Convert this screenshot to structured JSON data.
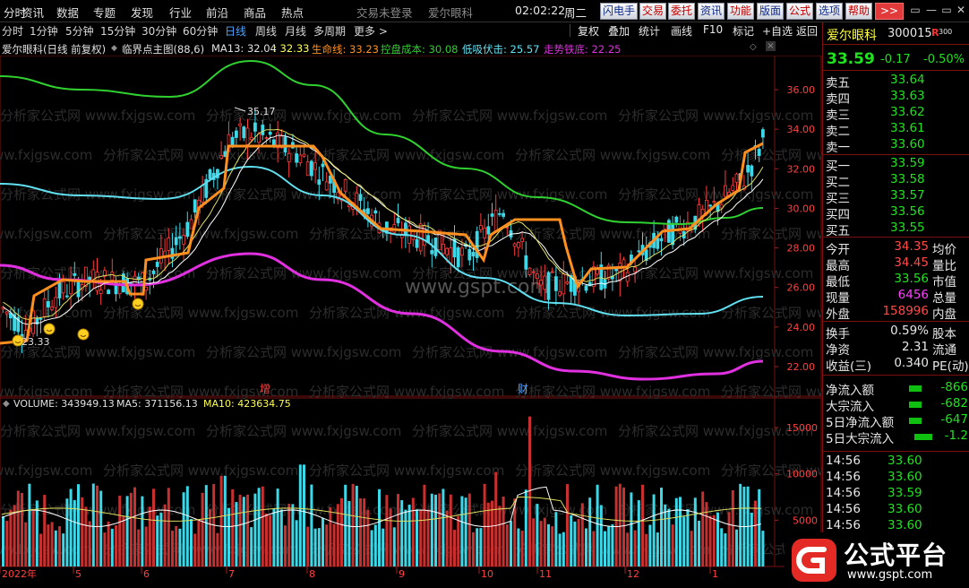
{
  "menubar": {
    "left_items": [
      "分时",
      "资讯",
      "数据",
      "专题",
      "发现",
      "行业",
      "前沿",
      "商品",
      "热点"
    ],
    "status_login": "交易未登录",
    "stock_name": "爱尔眼科",
    "time": "02:02:22",
    "weekday": "周二",
    "buttons": [
      {
        "label": "闪电手",
        "style": "blue"
      },
      {
        "label": "交易",
        "style": "red"
      },
      {
        "label": "委托",
        "style": "red"
      },
      {
        "label": "资讯",
        "style": "blue"
      },
      {
        "label": "功能",
        "style": "red"
      },
      {
        "label": "版面",
        "style": "blue"
      },
      {
        "label": "公式",
        "style": "red"
      },
      {
        "label": "选项",
        "style": "blue"
      },
      {
        "label": "帮助",
        "style": "red"
      },
      {
        "label": ">>",
        "style": "pink"
      }
    ],
    "window_buttons": [
      "▭",
      "—",
      "▭",
      "✕"
    ]
  },
  "periodbar": {
    "periods": [
      "分时",
      "1分钟",
      "5分钟",
      "15分钟",
      "30分钟",
      "60分钟",
      "日线",
      "周线",
      "月线",
      "多周期",
      "更多 >"
    ],
    "active": "日线",
    "tools": [
      "复权",
      "叠加",
      "统计",
      "画线",
      "F10",
      "标记",
      "+自选",
      "返回"
    ]
  },
  "indicator_header": {
    "title": "爱尔眼科(日线 前复权)",
    "sep": "◆",
    "formula": "临界点主图(88,6)",
    "ma13": "MA13: 32.04",
    "ma13b": ": 32.33",
    "life": "生命线: 33.23",
    "cost": "控盘成本: 30.08",
    "absorb": "低吸伏击: 25.57",
    "bottom": "走势铁底: 22.25"
  },
  "volume_header": {
    "volume": "VOLUME: 343949.13",
    "ma5": "MA5: 371156.13",
    "ma10": "MA10: 423634.75"
  },
  "chart_labels": {
    "peak": "35.17",
    "low": "23.33",
    "marker_zeng": "增",
    "marker_cai": "财",
    "watermark": "www.gspt.com",
    "watermark_repeat": "分析家公式网 www.fxjgsw.com"
  },
  "price_axis": [
    "36.00",
    "34.00",
    "32.00",
    "30.00",
    "28.00",
    "26.00",
    "24.00",
    "22.00"
  ],
  "volume_axis": [
    "15000",
    "10000",
    "5000"
  ],
  "date_axis": [
    "2022年",
    "5",
    "6",
    "7",
    "8",
    "9",
    "10",
    "11",
    "12",
    "1"
  ],
  "quote": {
    "name": "爱尔眼科",
    "code": "300015",
    "badge": "R",
    "badge_sup": "300",
    "price": "33.59",
    "change": "-0.17",
    "pct": "-0.50%",
    "asks": [
      {
        "label": "卖五",
        "price": "33.64"
      },
      {
        "label": "卖四",
        "price": "33.63"
      },
      {
        "label": "卖三",
        "price": "33.62"
      },
      {
        "label": "卖二",
        "price": "33.61"
      },
      {
        "label": "卖一",
        "price": "33.60"
      }
    ],
    "bids": [
      {
        "label": "买一",
        "price": "33.59"
      },
      {
        "label": "买二",
        "price": "33.58"
      },
      {
        "label": "买三",
        "price": "33.57"
      },
      {
        "label": "买四",
        "price": "33.56"
      },
      {
        "label": "买五",
        "price": "33.55"
      }
    ],
    "stats": [
      {
        "label": "今开",
        "value": "34.35",
        "label2": "均价"
      },
      {
        "label": "最高",
        "value": "34.45",
        "label2": "量比"
      },
      {
        "label": "最低",
        "value": "33.56",
        "label2": "市值"
      },
      {
        "label": "现量",
        "value": "6456",
        "label2": "总量"
      },
      {
        "label": "外盘",
        "value": "158996",
        "label2": "内盘"
      }
    ],
    "stats2": [
      {
        "label": "换手",
        "value": "0.59%",
        "label2": "股本"
      },
      {
        "label": "净资",
        "value": "2.31",
        "label2": "流通"
      },
      {
        "label": "收益(三)",
        "value": "0.340",
        "label2": "PE(动)"
      }
    ],
    "flows": [
      {
        "label": "净流入额",
        "value": "-866"
      },
      {
        "label": "大宗流入",
        "value": "-682"
      },
      {
        "label": "5日净流入额",
        "value": "-647"
      },
      {
        "label": "5日大宗流入",
        "value": "-1.2"
      }
    ],
    "ticks": [
      {
        "time": "14:56",
        "price": "33.60"
      },
      {
        "time": "14:56",
        "price": "33.60"
      },
      {
        "time": "14:56",
        "price": "33.59"
      },
      {
        "time": "14:56",
        "price": "33.60"
      },
      {
        "time": "14:56",
        "price": "33.60"
      }
    ]
  },
  "logo": {
    "text": "公式平台",
    "url": "www.gspt.com"
  },
  "colors": {
    "up": "#ff3c3c",
    "down": "#3cd8e8",
    "orange": "#ff9020",
    "green": "#30d030",
    "cyan": "#60e0f0",
    "magenta": "#e030e0"
  }
}
